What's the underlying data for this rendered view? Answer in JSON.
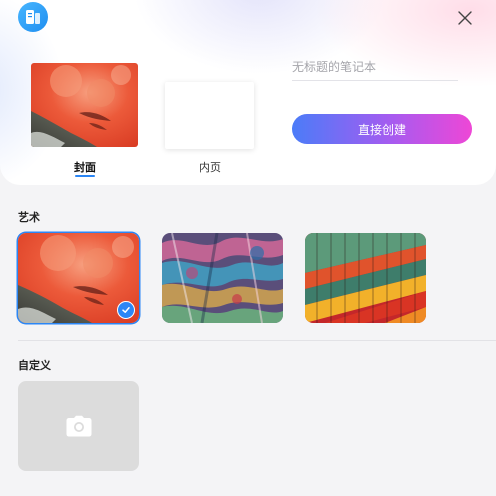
{
  "header": {
    "app_icon": "notebook-app-icon",
    "close_icon": "close-icon"
  },
  "preview": {
    "cover_tab": "封面",
    "inner_tab": "内页",
    "active_tab": "cover"
  },
  "form": {
    "title_placeholder": "无标题的笔记本",
    "title_value": "",
    "create_button": "直接创建"
  },
  "sections": {
    "art": {
      "title": "艺术",
      "covers": [
        {
          "name": "red-abstract",
          "selected": true
        },
        {
          "name": "colorful-texture",
          "selected": false
        },
        {
          "name": "stacked-stripes",
          "selected": false
        }
      ]
    },
    "custom": {
      "title": "自定义",
      "icon": "camera-icon"
    }
  },
  "colors": {
    "accent": "#2b86f5",
    "button_gradient_start": "#4b7cf8",
    "button_gradient_end": "#ee47d6"
  }
}
